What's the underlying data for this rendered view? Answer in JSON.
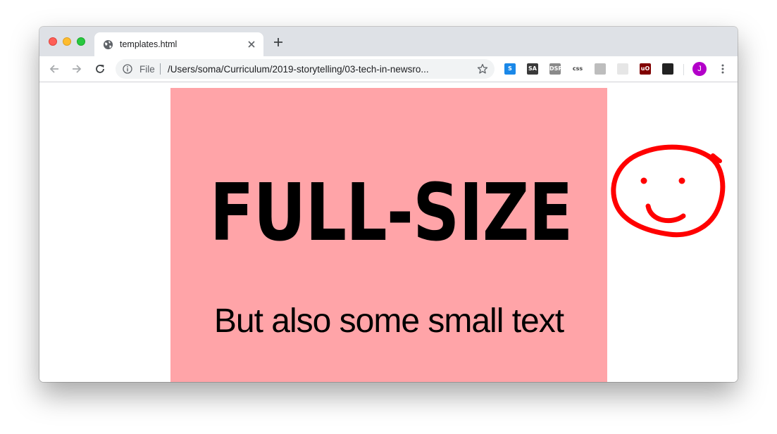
{
  "tab": {
    "title": "templates.html"
  },
  "omnibox": {
    "scheme": "File",
    "url": "/Users/soma/Curriculum/2019-storytelling/03-tech-in-newsro..."
  },
  "extensions": [
    {
      "name": "s-extension-icon",
      "label": "S",
      "color": "#1a88e8"
    },
    {
      "name": "sa-extension-icon",
      "label": "SA",
      "color": "#3a3a3a"
    },
    {
      "name": "dsp-extension-icon",
      "label": "DSP",
      "color": "#8a8a8a"
    },
    {
      "name": "css-extension-icon",
      "label": "css",
      "color": "#ffffff"
    },
    {
      "name": "circle-extension-icon",
      "label": "",
      "color": "#bdbdbd"
    },
    {
      "name": "grid-extension-icon",
      "label": "",
      "color": "#e6e6e6"
    },
    {
      "name": "ublock-extension-icon",
      "label": "uO",
      "color": "#800000"
    },
    {
      "name": "tampermonkey-extension-icon",
      "label": "",
      "color": "#222222"
    }
  ],
  "profile": {
    "initial": "J",
    "color": "#b300c9"
  },
  "page": {
    "headline": "FULL-SIZE",
    "subtext": "But also some small text",
    "slide_color": "#ffa4a8",
    "drawing_color": "#ff0000"
  }
}
